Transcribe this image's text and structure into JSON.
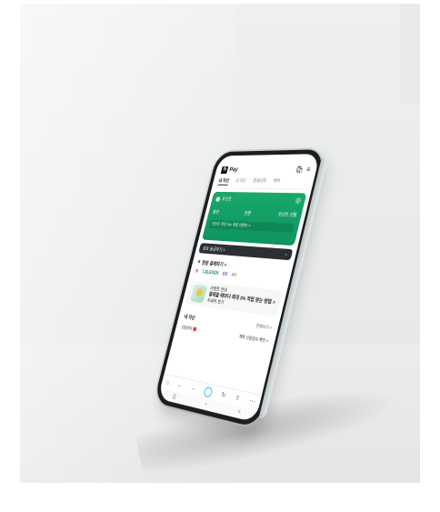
{
  "app": {
    "name": "Pay",
    "logo_letter": "N"
  },
  "tabs": [
    "내 자산",
    "내 자산",
    "결제내역",
    "혜택"
  ],
  "points_card": {
    "title": "포인트",
    "actions": [
      "충전",
      "전환",
      "포인트 선물"
    ],
    "promo": "포인트 쿠폰 5% 적립 이벤트 >"
  },
  "dark_bar": {
    "label": "포토 송금하기 >"
  },
  "payment_section": {
    "title": "현장 결제하기 >",
    "brands": [
      "7-ELEVEN",
      "CU",
      "AK"
    ]
  },
  "ad": {
    "small": "이벤트 안내",
    "big": "결제할 때마다 최대 3% 적립 받는 방법 >",
    "sub": "자세히 보기"
  },
  "assets": {
    "title": "내 자산",
    "link": "전체보기 >",
    "row_label": "신용관리",
    "row_value": "계좌 신용점수 확인 >"
  },
  "browser_bar": {
    "icons": [
      "home-icon",
      "back-icon",
      "forward-icon",
      "naver-icon",
      "refresh-icon",
      "share-icon",
      "more-icon"
    ]
  },
  "nav_bar": [
    "|||",
    "○",
    "<"
  ],
  "colors": {
    "card_green": "#19a86a",
    "dark_bar": "#2b2f33",
    "background": "#e9ebeb"
  }
}
